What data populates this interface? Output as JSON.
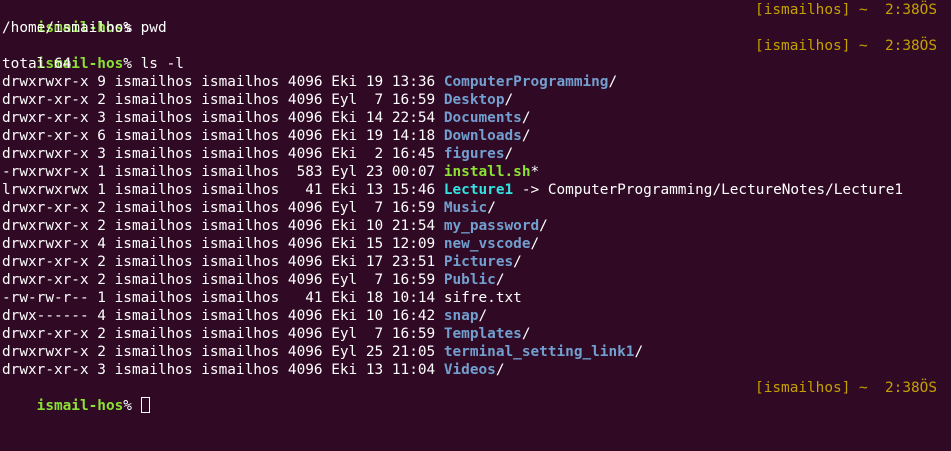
{
  "prompt": {
    "user_host": "ismail-hos",
    "symbol": "% ",
    "right_open": "[",
    "right_user": "ismailhos",
    "right_close": "]",
    "right_rest": " ~  2:38ÖS"
  },
  "session": [
    {
      "command": "pwd"
    },
    {
      "output": "/home/ismailhos"
    },
    {
      "command": "ls -l"
    },
    {
      "output": "total 64"
    }
  ],
  "listing": [
    {
      "meta": "drwxrwxr-x 9 ismailhos ismailhos 4096 Eki 19 13:36 ",
      "name": "ComputerProgramming",
      "suffix": "/",
      "kind": "dir"
    },
    {
      "meta": "drwxr-xr-x 2 ismailhos ismailhos 4096 Eyl  7 16:59 ",
      "name": "Desktop",
      "suffix": "/",
      "kind": "dir"
    },
    {
      "meta": "drwxr-xr-x 3 ismailhos ismailhos 4096 Eki 14 22:54 ",
      "name": "Documents",
      "suffix": "/",
      "kind": "dir"
    },
    {
      "meta": "drwxr-xr-x 6 ismailhos ismailhos 4096 Eki 19 14:18 ",
      "name": "Downloads",
      "suffix": "/",
      "kind": "dir"
    },
    {
      "meta": "drwxrwxr-x 3 ismailhos ismailhos 4096 Eki  2 16:45 ",
      "name": "figures",
      "suffix": "/",
      "kind": "dir"
    },
    {
      "meta": "-rwxrwxr-x 1 ismailhos ismailhos  583 Eyl 23 00:07 ",
      "name": "install.sh",
      "suffix": "*",
      "kind": "exec"
    },
    {
      "meta": "lrwxrwxrwx 1 ismailhos ismailhos   41 Eki 13 15:46 ",
      "name": "Lecture1",
      "suffix": " -> ComputerProgramming/LectureNotes/Lecture1",
      "kind": "link"
    },
    {
      "meta": "drwxr-xr-x 2 ismailhos ismailhos 4096 Eyl  7 16:59 ",
      "name": "Music",
      "suffix": "/",
      "kind": "dir"
    },
    {
      "meta": "drwxrwxr-x 2 ismailhos ismailhos 4096 Eki 10 21:54 ",
      "name": "my_password",
      "suffix": "/",
      "kind": "dir"
    },
    {
      "meta": "drwxrwxr-x 4 ismailhos ismailhos 4096 Eki 15 12:09 ",
      "name": "new_vscode",
      "suffix": "/",
      "kind": "dir"
    },
    {
      "meta": "drwxr-xr-x 2 ismailhos ismailhos 4096 Eki 17 23:51 ",
      "name": "Pictures",
      "suffix": "/",
      "kind": "dir"
    },
    {
      "meta": "drwxr-xr-x 2 ismailhos ismailhos 4096 Eyl  7 16:59 ",
      "name": "Public",
      "suffix": "/",
      "kind": "dir"
    },
    {
      "meta": "-rw-rw-r-- 1 ismailhos ismailhos   41 Eki 18 10:14 ",
      "name": "sifre.txt",
      "suffix": "",
      "kind": "file"
    },
    {
      "meta": "drwx------ 4 ismailhos ismailhos 4096 Eki 10 16:42 ",
      "name": "snap",
      "suffix": "/",
      "kind": "dir"
    },
    {
      "meta": "drwxr-xr-x 2 ismailhos ismailhos 4096 Eyl  7 16:59 ",
      "name": "Templates",
      "suffix": "/",
      "kind": "dir"
    },
    {
      "meta": "drwxrwxr-x 2 ismailhos ismailhos 4096 Eyl 25 21:05 ",
      "name": "terminal_setting_link1",
      "suffix": "/",
      "kind": "dir"
    },
    {
      "meta": "drwxr-xr-x 3 ismailhos ismailhos 4096 Eki 13 11:04 ",
      "name": "Videos",
      "suffix": "/",
      "kind": "dir"
    }
  ],
  "colors": {
    "background": "#300a24",
    "prompt": "#8ae234",
    "directory": "#729fcf",
    "symlink": "#34e2e2",
    "executable": "#8ae234",
    "right_prompt": "#c4a000"
  }
}
